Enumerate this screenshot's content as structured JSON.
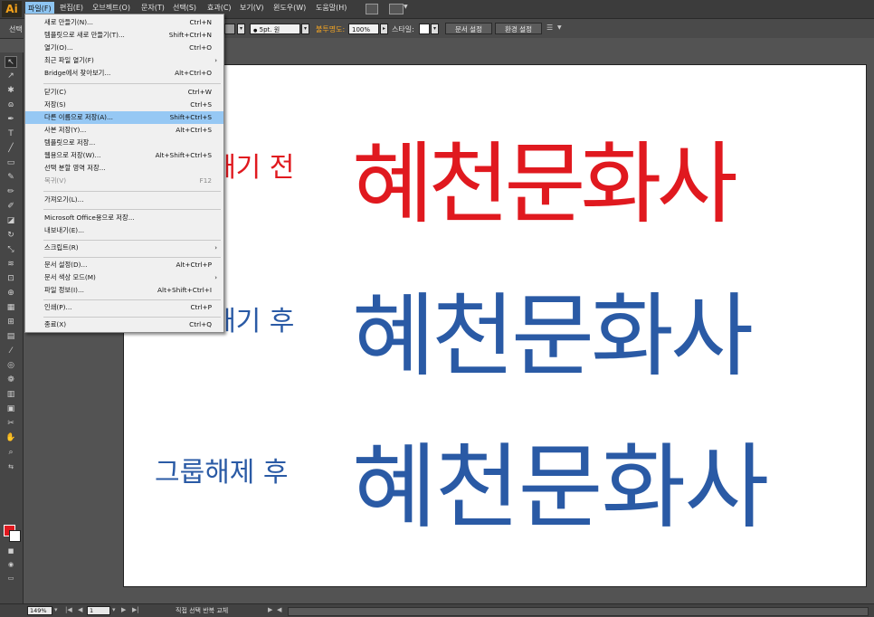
{
  "app": {
    "logo": "Ai"
  },
  "menubar": {
    "items": [
      "파일(F)",
      "편집(E)",
      "오브젝트(O)",
      "문자(T)",
      "선택(S)",
      "효과(C)",
      "보기(V)",
      "윈도우(W)",
      "도움말(H)"
    ]
  },
  "controlbar": {
    "selection_label": "선택",
    "stroke_profile": "5pt. 원",
    "opacity_label": "불투명도:",
    "opacity_value": "100%",
    "style_label": "스타일:",
    "doc_setup_button": "문서 설정",
    "prefs_button": "환경 설정"
  },
  "file_menu": {
    "items": [
      {
        "label": "새로 만들기(N)...",
        "shortcut": "Ctrl+N"
      },
      {
        "label": "템플릿으로 새로 만들기(T)...",
        "shortcut": "Shift+Ctrl+N"
      },
      {
        "label": "열기(O)...",
        "shortcut": "Ctrl+O"
      },
      {
        "label": "최근 파일 열기(F)",
        "shortcut": "",
        "submenu": true
      },
      {
        "label": "Bridge에서 찾아보기...",
        "shortcut": "Alt+Ctrl+O"
      },
      {
        "label": "닫기(C)",
        "shortcut": "Ctrl+W"
      },
      {
        "label": "저장(S)",
        "shortcut": "Ctrl+S"
      },
      {
        "label": "다른 이름으로 저장(A)...",
        "shortcut": "Shift+Ctrl+S",
        "highlighted": true
      },
      {
        "label": "사본 저장(Y)...",
        "shortcut": "Alt+Ctrl+S"
      },
      {
        "label": "템플릿으로 저장...",
        "shortcut": ""
      },
      {
        "label": "웹용으로 저장(W)...",
        "shortcut": "Alt+Shift+Ctrl+S"
      },
      {
        "label": "선택 분할 영역 저장...",
        "shortcut": ""
      },
      {
        "label": "복귀(V)",
        "shortcut": "F12",
        "disabled": true
      },
      {
        "label": "가져오기(L)...",
        "shortcut": ""
      },
      {
        "label": "Microsoft Office용으로 저장...",
        "shortcut": ""
      },
      {
        "label": "내보내기(E)...",
        "shortcut": ""
      },
      {
        "label": "스크립트(R)",
        "shortcut": "",
        "submenu": true
      },
      {
        "label": "문서 설정(D)...",
        "shortcut": "Alt+Ctrl+P"
      },
      {
        "label": "문서 색상 모드(M)",
        "shortcut": "",
        "submenu": true
      },
      {
        "label": "파일 정보(I)...",
        "shortcut": "Alt+Shift+Ctrl+I"
      },
      {
        "label": "인쇄(P)...",
        "shortcut": "Ctrl+P"
      },
      {
        "label": "종료(X)",
        "shortcut": "Ctrl+Q"
      }
    ]
  },
  "artboard": {
    "rows": [
      {
        "label": "깨기 전",
        "text": "혜천문화사",
        "color": "#e0191f"
      },
      {
        "label": "깨기 후",
        "text": "혜천문화사",
        "color": "#2a5aa5"
      },
      {
        "label": "그룹해제 후",
        "text": "혜천문화사",
        "color": "#2a5aa5"
      }
    ]
  },
  "statusbar": {
    "zoom": "149%",
    "artboard_number": "1",
    "status_text": "직접 선택 반복 교체"
  }
}
